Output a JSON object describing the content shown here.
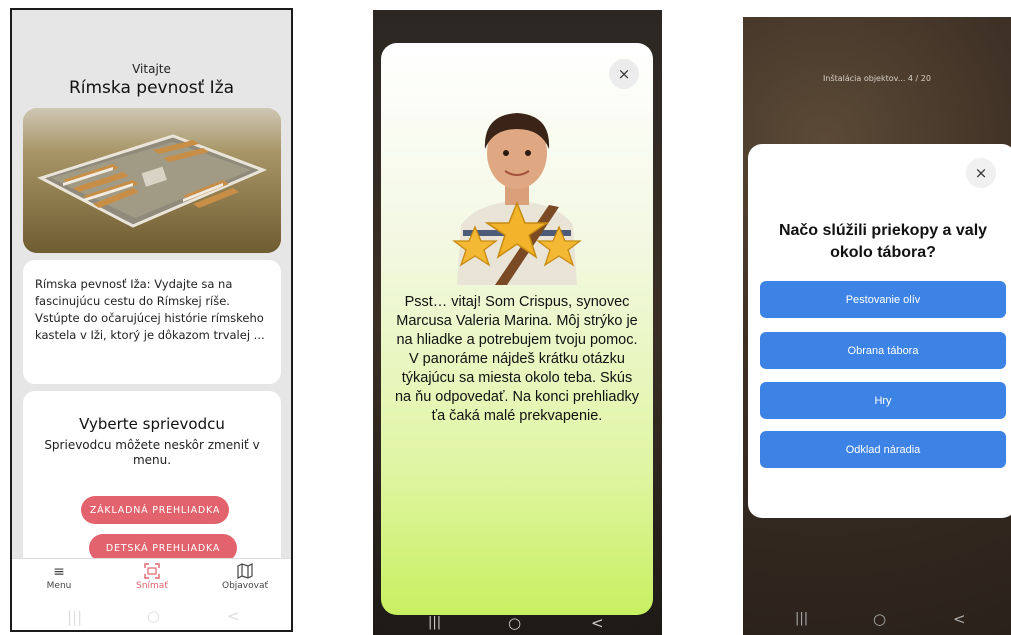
{
  "screen1": {
    "welcome": "Vitajte",
    "title": "Rímska pevnosť Iža",
    "description": "Rímska pevnosť Iža: Vydajte sa na fascinujúcu cestu do Rímskej ríše. Vstúpte do očarujúcej histórie rímskeho kastela v Iži, ktorý je dôkazom trvalej ...",
    "guide_title": "Vyberte sprievodcu",
    "guide_subtitle": "Sprievodcu môžete neskôr zmeniť v menu.",
    "buttons": [
      "ZÁKLADNÁ PREHLIADKA",
      "DETSKÁ PREHLIADKA"
    ],
    "nav": [
      {
        "label": "Menu",
        "icon": "hamburger-icon"
      },
      {
        "label": "Snímať",
        "icon": "scan-icon",
        "active": true
      },
      {
        "label": "Objavovať",
        "icon": "map-icon"
      }
    ],
    "colors": {
      "accent": "#e2636d",
      "background": "#e6e6e6"
    }
  },
  "screen2": {
    "close": "×",
    "message": "Psst… vitaj! Som Crispus, synovec Marcusa Valeria Marina. Môj strýko je na hliadke a potrebujem tvoju pomoc. V panoráme nájdeš krátku otázku týkajúcu sa miesta okolo teba. Skús na ňu odpovedať. Na konci prehliadky ťa čaká malé prekvapenie.",
    "colors": {
      "gradient_end": "#c8f060"
    }
  },
  "screen3": {
    "loading": "Inštalácia objektov... 4 / 20",
    "close": "×",
    "question": "Načo slúžili priekopy a valy okolo tábora?",
    "options": [
      "Pestovanie olív",
      "Obrana tábora",
      "Hry",
      "Odklad náradia"
    ],
    "colors": {
      "button": "#3d83e6"
    }
  },
  "system_nav": {
    "recents": "|||",
    "home": "○",
    "back": "<"
  }
}
